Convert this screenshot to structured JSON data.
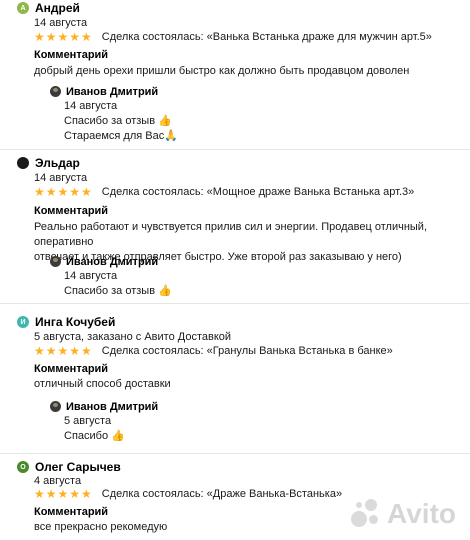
{
  "reviews": [
    {
      "author": "Андрей",
      "avatar_letter": "А",
      "avatar_color": "#8fb84a",
      "date": "14 августа",
      "stars": "★★★★★",
      "deal": "Сделка состоялась: «Ванька Встанька драже для мужчин арт.5»",
      "comment_label": "Комментарий",
      "comment": "добрый день орехи пришли быстро как должно быть продавцом доволен",
      "reply": {
        "author": "Иванов Дмитрий",
        "lines": [
          "14 августа",
          "Спасибо за отзыв 👍",
          "Стараемся для Вас🙏"
        ]
      }
    },
    {
      "author": "Эльдар",
      "avatar_letter": "",
      "avatar_color": "#1a1a1a",
      "date": "14 августа",
      "stars": "★★★★★",
      "deal": "Сделка состоялась: «Мощное драже Ванька Встанька арт.3»",
      "comment_label": "Комментарий",
      "comment_lines": [
        "Реально работают и чувствуется прилив сил и энергии. Продавец отличный, оперативно",
        "отвечает и также отправляет быстро. Уже второй раз заказываю у него)"
      ],
      "reply": {
        "author": "Иванов Дмитрий",
        "lines": [
          "14 августа",
          "Спасибо за отзыв 👍"
        ]
      }
    },
    {
      "author": "Инга Кочубей",
      "avatar_letter": "И",
      "avatar_color": "#3fb6b0",
      "date": "5 августа, заказано с Авито Доставкой",
      "stars": "★★★★★",
      "deal": "Сделка состоялась: «Гранулы Ванька Встанька в банке»",
      "comment_label": "Комментарий",
      "comment": "отличный способ доставки",
      "reply": {
        "author": "Иванов Дмитрий",
        "lines": [
          "5 августа",
          "Спасибо 👍"
        ]
      }
    },
    {
      "author": "Олег Сарычев",
      "avatar_letter": "О",
      "avatar_color": "#4a8a2a",
      "date": "4 августа",
      "stars": "★★★★★",
      "deal": "Сделка состоялась: «Драже Ванька-Встанька»",
      "comment_label": "Комментарий",
      "comment": "все прекрасно рекомедую"
    }
  ],
  "watermark": {
    "text": "Avito"
  }
}
